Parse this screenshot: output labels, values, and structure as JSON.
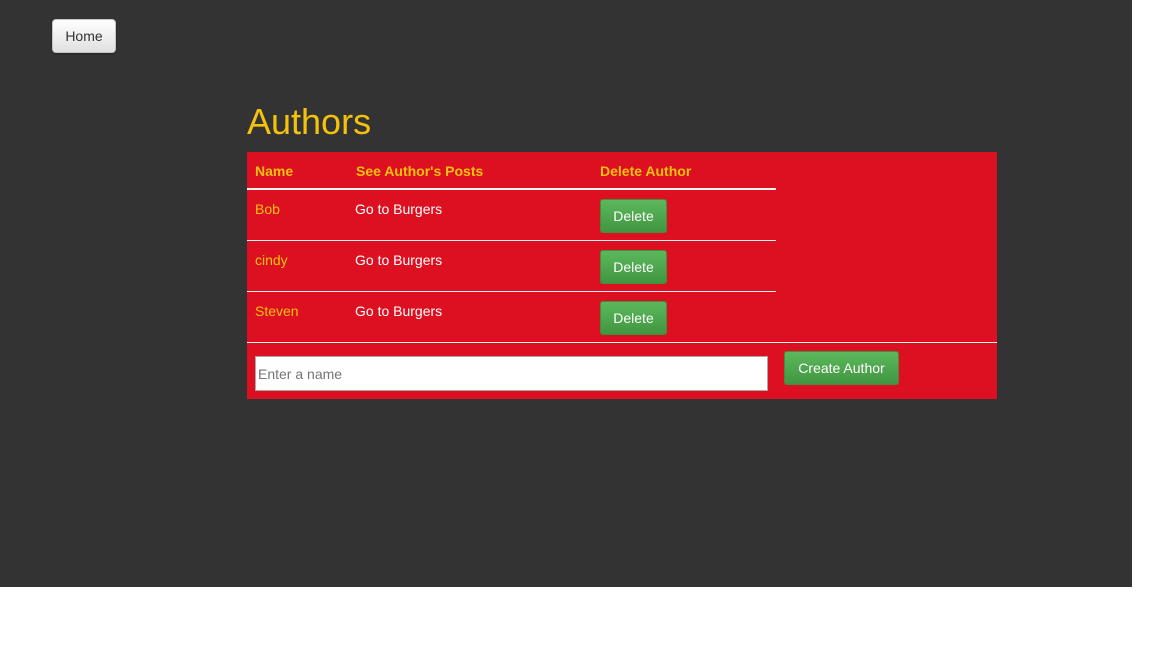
{
  "nav": {
    "home_label": "Home"
  },
  "page": {
    "title": "Authors"
  },
  "table": {
    "headers": {
      "name": "Name",
      "posts": "See Author's Posts",
      "delete": "Delete Author"
    },
    "rows": [
      {
        "name": "Bob",
        "posts_link": "Go to Burgers",
        "delete_label": "Delete"
      },
      {
        "name": "cindy",
        "posts_link": "Go to Burgers",
        "delete_label": "Delete"
      },
      {
        "name": "Steven",
        "posts_link": "Go to Burgers",
        "delete_label": "Delete"
      }
    ]
  },
  "form": {
    "placeholder": "Enter a name",
    "value": "",
    "submit_label": "Create Author"
  },
  "colors": {
    "background": "#333333",
    "panel": "#dc1021",
    "accent_text": "#f4c20d",
    "button_green": "#4cae4c"
  }
}
